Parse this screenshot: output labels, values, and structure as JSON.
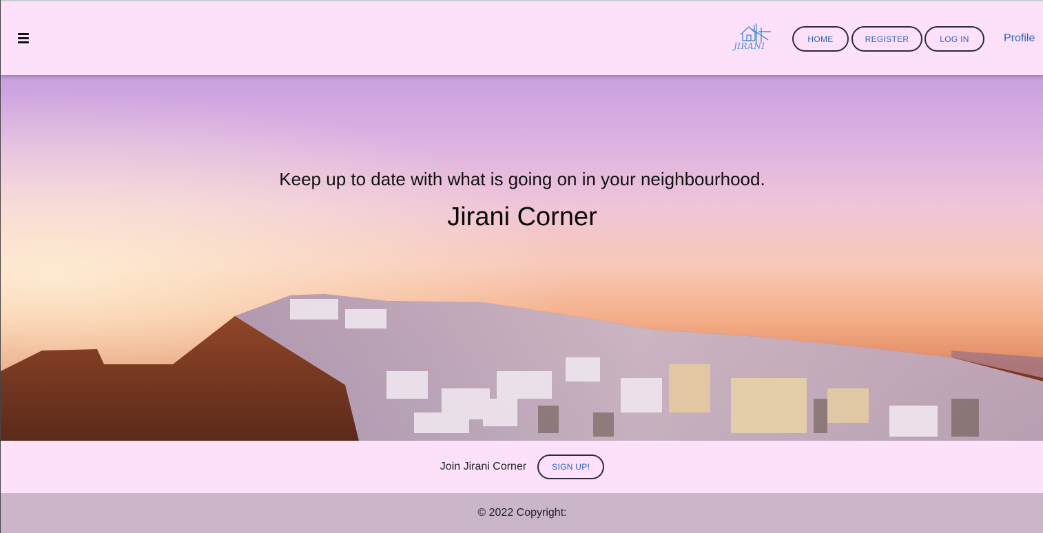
{
  "nav": {
    "menu_icon": "hamburger-menu-icon",
    "logo_text": "JIRANI",
    "home_label": "HOME",
    "register_label": "REGISTER",
    "login_label": "LOG IN",
    "profile_label": "Profile"
  },
  "hero": {
    "tagline": "Keep up to date with what is going on in your neighbourhood.",
    "title": "Jirani Corner"
  },
  "cta": {
    "label": "Join Jirani Corner",
    "signup_label": "SIGN UP!"
  },
  "footer": {
    "copyright": "© 2022 Copyright:"
  },
  "colors": {
    "page_bg": "#fde0fa",
    "accent_text": "#2a63c4",
    "footer_bg": "#cbb5c9"
  }
}
